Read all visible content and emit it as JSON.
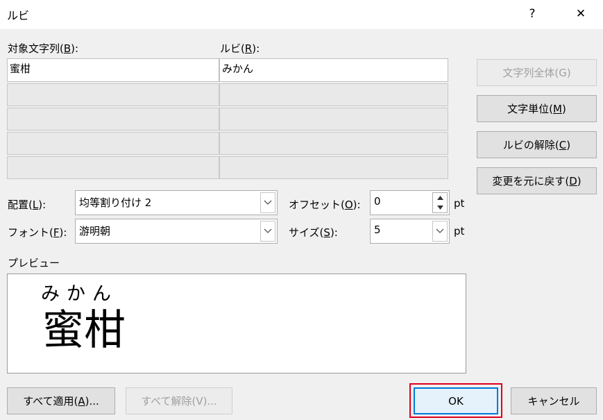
{
  "dialog": {
    "title": "ルビ",
    "help_glyph": "?",
    "close_glyph": "✕"
  },
  "grid": {
    "target_label_prefix": "対象文字列(",
    "target_label_key": "B",
    "target_label_suffix": "):",
    "ruby_label_prefix": "ルビ(",
    "ruby_label_key": "R",
    "ruby_label_suffix": "):",
    "rows": [
      {
        "target": "蜜柑",
        "ruby": "みかん"
      },
      {
        "target": "",
        "ruby": ""
      },
      {
        "target": "",
        "ruby": ""
      },
      {
        "target": "",
        "ruby": ""
      },
      {
        "target": "",
        "ruby": ""
      }
    ]
  },
  "side_buttons": {
    "whole_prefix": "文字列全体(",
    "whole_key": "G",
    "whole_suffix": ")",
    "char_prefix": "文字単位(",
    "char_key": "M",
    "char_suffix": ")",
    "remove_prefix": "ルビの解除(",
    "remove_key": "C",
    "remove_suffix": ")",
    "revert_prefix": "変更を元に戻す(",
    "revert_key": "D",
    "revert_suffix": ")"
  },
  "settings": {
    "align_prefix": "配置(",
    "align_key": "L",
    "align_suffix": "):",
    "align_value": "均等割り付け 2",
    "font_prefix": "フォント(",
    "font_key": "F",
    "font_suffix": "):",
    "font_value": "游明朝",
    "offset_prefix": "オフセット(",
    "offset_key": "O",
    "offset_suffix": "):",
    "offset_value": "0",
    "offset_unit": "pt",
    "size_prefix": "サイズ(",
    "size_key": "S",
    "size_suffix": "):",
    "size_value": "5",
    "size_unit": "pt"
  },
  "preview": {
    "label": "プレビュー",
    "ruby_text": "みかん",
    "base_text": "蜜柑"
  },
  "bottom": {
    "apply_all_prefix": "すべて適用(",
    "apply_all_key": "A",
    "apply_all_suffix": ")...",
    "remove_all_label": "すべて解除(V)...",
    "ok_label": "OK",
    "cancel_label": "キャンセル"
  }
}
